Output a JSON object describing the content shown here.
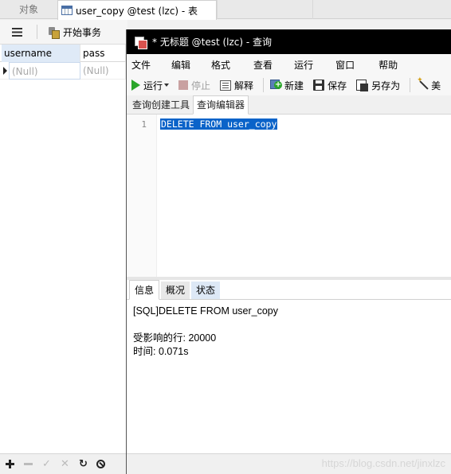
{
  "background_window": {
    "tabs": {
      "objects": "对象",
      "table": "user_copy @test (lzc) - 表"
    },
    "toolbar": {
      "begin_transaction": "开始事务"
    },
    "grid": {
      "columns": [
        "username",
        "pass"
      ],
      "rows": [
        [
          "(Null)",
          "(Null)"
        ]
      ]
    }
  },
  "query_window": {
    "title": "* 无标题 @test (lzc) - 查询",
    "menu": [
      "文件",
      "编辑",
      "格式",
      "查看",
      "运行",
      "窗口",
      "帮助"
    ],
    "toolbar": {
      "run": "运行",
      "stop": "停止",
      "explain": "解释",
      "new": "新建",
      "save": "保存",
      "save_as": "另存为",
      "beautify": "美"
    },
    "tabs": [
      "查询创建工具",
      "查询编辑器"
    ],
    "editor": {
      "line_number": "1",
      "sql": "DELETE FROM user_copy"
    },
    "result_tabs": [
      "信息",
      "概况",
      "状态"
    ],
    "result": {
      "line1": "[SQL]DELETE FROM user_copy",
      "line2": "受影响的行: 20000",
      "line3": "时间: 0.071s"
    },
    "watermark": "https://blog.csdn.net/jinxlzc"
  }
}
